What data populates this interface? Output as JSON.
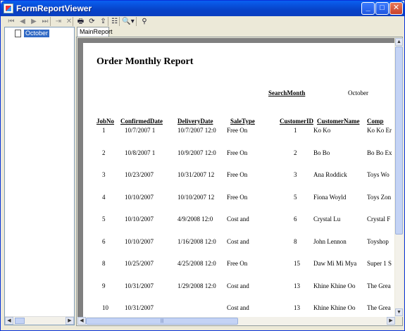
{
  "window": {
    "title": "FormReportViewer"
  },
  "titlebar_buttons": {
    "minimize": "_",
    "maximize": "□",
    "close": "✕"
  },
  "toolbar": [
    {
      "name": "first-page-icon",
      "glyph": "⏮",
      "enabled": false
    },
    {
      "name": "previous-page-icon",
      "glyph": "◀",
      "enabled": false
    },
    {
      "name": "next-page-icon",
      "glyph": "▶",
      "enabled": false
    },
    {
      "name": "last-page-icon",
      "glyph": "⏭",
      "enabled": false
    },
    {
      "name": "go-back-icon",
      "glyph": "⇥",
      "enabled": false
    },
    {
      "name": "stop-icon",
      "glyph": "✕",
      "enabled": false
    },
    {
      "name": "print-icon",
      "glyph": "🖶",
      "enabled": true
    },
    {
      "name": "refresh-icon",
      "glyph": "⟳",
      "enabled": true
    },
    {
      "name": "export-icon",
      "glyph": "⇪",
      "enabled": true
    },
    {
      "name": "group-tree-icon",
      "glyph": "☷",
      "enabled": true
    },
    {
      "name": "zoom-icon",
      "glyph": "🔍▾",
      "enabled": true
    },
    {
      "name": "search-icon",
      "glyph": "⚲",
      "enabled": true
    }
  ],
  "tree": {
    "items": [
      {
        "label": "October"
      }
    ]
  },
  "tabs": [
    {
      "label": "MainReport"
    }
  ],
  "report": {
    "title": "Order Monthly Report",
    "search_label": "SearchMonth",
    "search_value": "October",
    "columns": [
      "JobNo",
      "ConfirmedDate",
      "DeliveryDate",
      "SaleType",
      "CustomerID",
      "CustomerName",
      "Comp"
    ],
    "rows": [
      [
        "1",
        "10/7/2007  1",
        "10/7/2007  12:0",
        "Free On",
        "1",
        "Ko Ko",
        "Ko Ko Er"
      ],
      [
        "2",
        "10/8/2007  1",
        "10/9/2007  12:0",
        "Free On",
        "2",
        "Bo Bo",
        "Bo Bo Ex"
      ],
      [
        "3",
        "10/23/2007",
        "10/31/2007  12",
        "Free On",
        "3",
        "Ana Roddick",
        "Toys Wo"
      ],
      [
        "4",
        "10/10/2007",
        "10/10/2007  12",
        "Free On",
        "5",
        "Fiona Woyld",
        "Toys Zon"
      ],
      [
        "5",
        "10/10/2007",
        "4/9/2008  12:0",
        "Cost and",
        "6",
        "Crystal Lu",
        "Crystal F"
      ],
      [
        "6",
        "10/10/2007",
        "1/16/2008  12:0",
        "Cost and",
        "8",
        "John Lennon",
        "Toyshop"
      ],
      [
        "8",
        "10/25/2007",
        "4/25/2008  12:0",
        "Free On",
        "15",
        "Daw Mi Mi Mya",
        "Super 1 S"
      ],
      [
        "9",
        "10/31/2007",
        "1/29/2008  12:0",
        "Cost and",
        "13",
        "Khine Khine Oo",
        "The Grea"
      ],
      [
        "10",
        "10/31/2007",
        "",
        "Cost and",
        "13",
        "Khine Khine Oo",
        "The Grea"
      ]
    ]
  },
  "scroll": {
    "grip": "|||"
  },
  "colors": {
    "titlebar": "#0A5FF0",
    "selection": "#316AC5",
    "viewport": "#808080"
  }
}
